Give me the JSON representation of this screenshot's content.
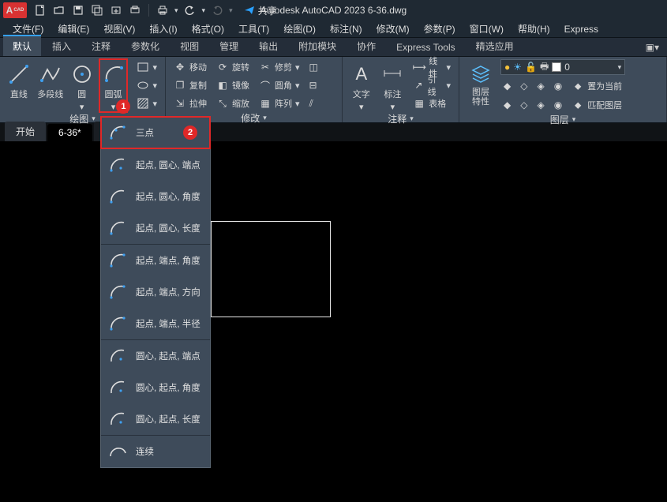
{
  "titlebar": {
    "logo_text": "A",
    "logo_sub": "CAD",
    "share_label": "共享",
    "app_title": "Autodesk AutoCAD 2023   6-36.dwg"
  },
  "menubar": [
    "文件(F)",
    "编辑(E)",
    "视图(V)",
    "插入(I)",
    "格式(O)",
    "工具(T)",
    "绘图(D)",
    "标注(N)",
    "修改(M)",
    "参数(P)",
    "窗口(W)",
    "帮助(H)",
    "Express"
  ],
  "ribbon_tabs": [
    "默认",
    "插入",
    "注释",
    "参数化",
    "视图",
    "管理",
    "输出",
    "附加模块",
    "协作",
    "Express Tools",
    "精选应用"
  ],
  "active_ribbon_tab": 0,
  "ribbon": {
    "draw_panel_title": "绘图",
    "line": "直线",
    "polyline": "多段线",
    "circle": "圆",
    "arc": "圆弧",
    "modify_panel_title": "修改",
    "move": "移动",
    "rotate": "旋转",
    "trim": "修剪",
    "copy": "复制",
    "mirror": "镜像",
    "fillet": "圆角",
    "stretch": "拉伸",
    "scale": "缩放",
    "array": "阵列",
    "annot_panel_title": "注释",
    "text": "文字",
    "dim": "标注",
    "linetype": "线性",
    "leader": "引线",
    "table": "表格",
    "layer_panel_title": "图层",
    "layer_props": "图层\n特性",
    "setcurrent": "置为当前",
    "matchlayer": "匹配图层",
    "current_layer": "0"
  },
  "doctabs": [
    "开始",
    "6-36*",
    "＋"
  ],
  "flyout": {
    "items": [
      "三点",
      "起点, 圆心, 端点",
      "起点, 圆心, 角度",
      "起点, 圆心, 长度",
      "起点, 端点, 角度",
      "起点, 端点, 方向",
      "起点, 端点, 半径",
      "圆心, 起点, 端点",
      "圆心, 起点, 角度",
      "圆心, 起点, 长度",
      "连续"
    ],
    "badge1": "1",
    "badge2": "2"
  }
}
